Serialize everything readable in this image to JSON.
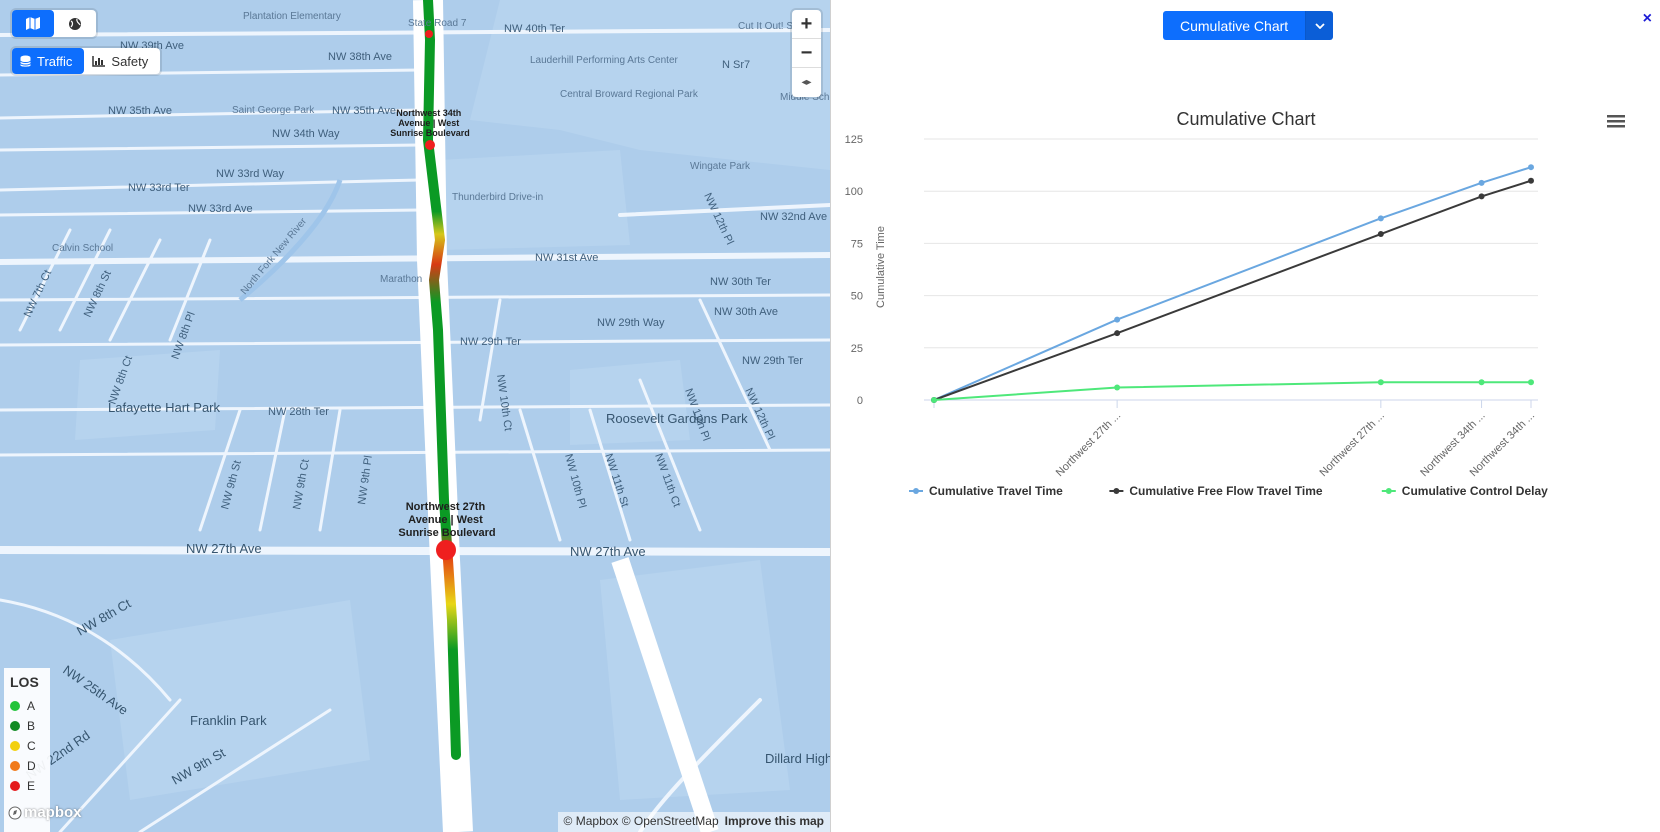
{
  "map": {
    "mode_buttons": [
      {
        "icon": "map-icon",
        "active": true
      },
      {
        "icon": "globe-icon",
        "active": false
      }
    ],
    "layers": [
      {
        "label": "Traffic",
        "icon": "database-icon",
        "active": true
      },
      {
        "label": "Safety",
        "icon": "bar-chart-icon",
        "active": false
      }
    ],
    "zoom": {
      "in": "+",
      "out": "−",
      "compass": "◂▸"
    },
    "streets": [
      "NW 27th Ave",
      "NW 27th Ave",
      "NW 31st Ave",
      "NW 29th Ter",
      "NW 29th Way",
      "NW 30th Ter",
      "NW 30th Ave",
      "NW 29th Ter",
      "NW 28th Ter",
      "NW 32nd Ave",
      "NW 33rd Ave",
      "NW 33rd Ter",
      "NW 33rd Way",
      "NW 34th Way",
      "NW 35th Ave",
      "NW 35th Ave",
      "NW 38th Ave",
      "NW 39th Ave",
      "NW 40th Ter",
      "NW 8th Ct",
      "NW 25th Ave",
      "NW 22nd Rd",
      "NW 9th St",
      "NW 9th St",
      "NW 9th Ct",
      "NW 9th Pl",
      "NW 10th Pl",
      "NW 11th St",
      "NW 11th Ct",
      "NW 11th Pl",
      "NW 12th Pl",
      "NW 10th Ct",
      "NW 8th Pl",
      "NW 8th Ct",
      "NW 7th Ct",
      "NW 8th St",
      "NW 12th Pl",
      "N Sr7"
    ],
    "pois": [
      "Plantation Elementary",
      "Lauderhill Performing Arts Center",
      "Central Broward Regional Park",
      "Wingate Park",
      "Thunderbird Drive-in",
      "Calvin School",
      "Marathon",
      "Lafayette Hart Park",
      "Roosevelt Gardens Park",
      "Franklin Park",
      "Dillard High",
      "Saint George Park",
      "North Fork New River",
      "Cut It Out! Salon",
      "Middle School",
      "State Road 7"
    ],
    "node_labels": [
      {
        "lines": [
          "Northwest 34th",
          "Avenue | West",
          "Sunrise Boulevard"
        ]
      },
      {
        "lines": [
          "Northwest 27th",
          "Avenue | West",
          "Sunrise Boulevard"
        ]
      }
    ],
    "los_legend": {
      "title": "LOS",
      "items": [
        {
          "label": "A",
          "color": "#22c33a"
        },
        {
          "label": "B",
          "color": "#118a24"
        },
        {
          "label": "C",
          "color": "#f2d00e"
        },
        {
          "label": "D",
          "color": "#f07a1a"
        },
        {
          "label": "E",
          "color": "#e41a1c"
        }
      ]
    },
    "logo": "mapbox",
    "attribution": {
      "text": "© Mapbox © OpenStreetMap",
      "improve": "Improve this map"
    }
  },
  "panel": {
    "chart_select_label": "Cumulative Chart",
    "close_icon": "×"
  },
  "chart_data": {
    "type": "line",
    "title": "Cumulative Chart",
    "xlabel": "",
    "ylabel": "Cumulative Time",
    "ylim": [
      0,
      125
    ],
    "yticks": [
      0,
      25,
      50,
      75,
      100,
      125
    ],
    "x_positions": [
      0,
      1.0,
      2.44,
      2.99,
      3.26
    ],
    "categories": [
      "",
      "Northwest 27th ...",
      "Northwest 27th ...",
      "Northwest 34th ...",
      "Northwest 34th ..."
    ],
    "grid": true,
    "legend": "bottom",
    "series": [
      {
        "name": "Cumulative Travel Time",
        "color": "#6aa7e0",
        "values": [
          0,
          38.5,
          87,
          104,
          111.5
        ]
      },
      {
        "name": "Cumulative Free Flow Travel Time",
        "color": "#3a3a3a",
        "values": [
          0,
          32,
          79.5,
          97.5,
          105
        ]
      },
      {
        "name": "Cumulative Control Delay",
        "color": "#4ee87a",
        "values": [
          0,
          6,
          8.5,
          8.5,
          8.5
        ]
      }
    ]
  }
}
